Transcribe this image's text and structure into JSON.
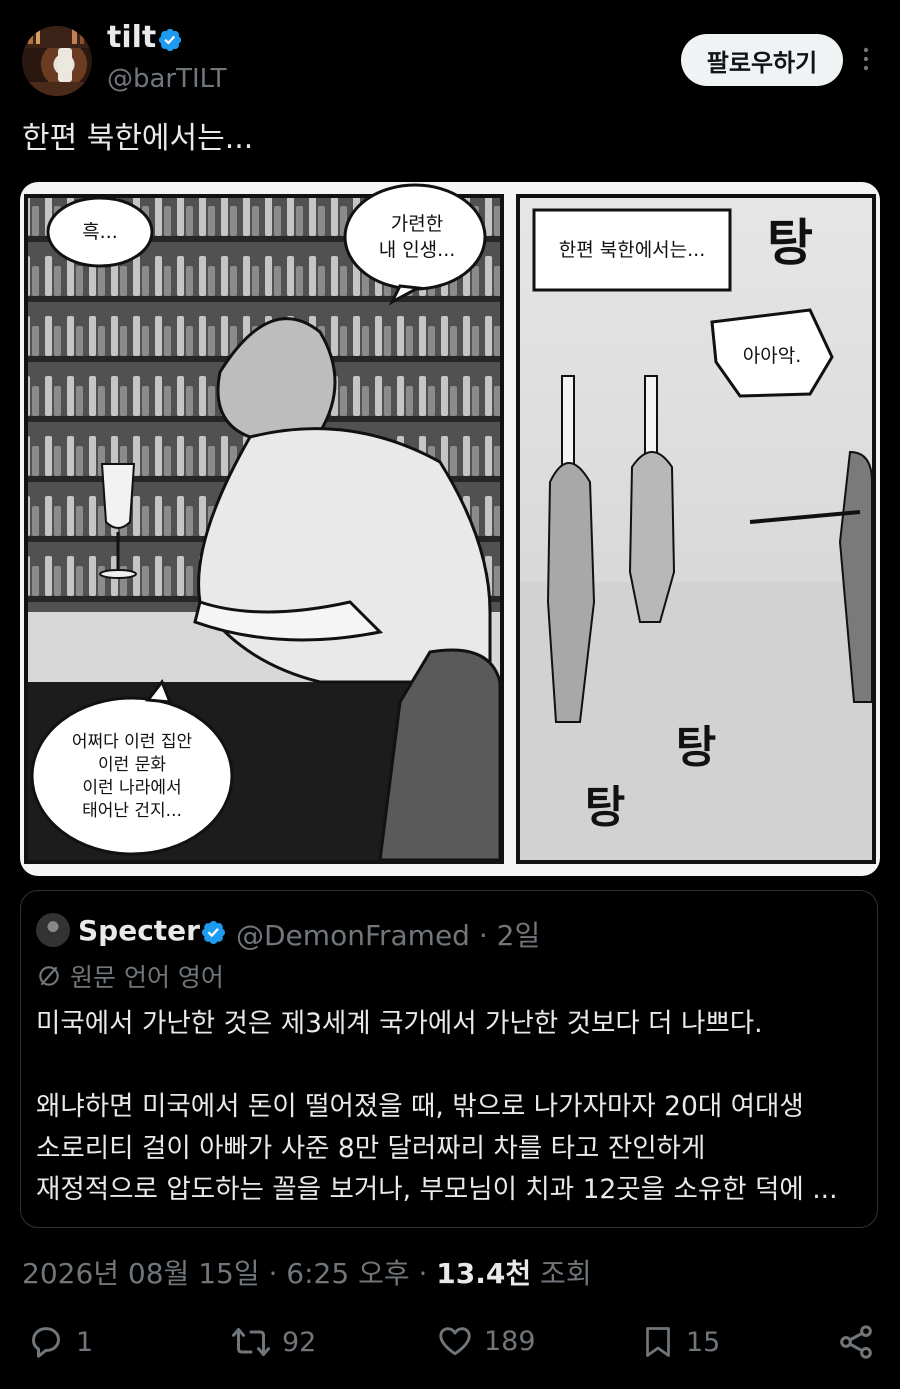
{
  "author": {
    "name": "tilt",
    "handle": "@barTILT"
  },
  "follow_label": "팔로우하기",
  "tweet_text": "한편 북한에서는...",
  "comic": {
    "bubble_heuk": "흑...",
    "bubble_pitiful_1": "가련한",
    "bubble_pitiful_2": "내 인생...",
    "bubble_born_1": "어쩌다 이런 집안",
    "bubble_born_2": "이런 문화",
    "bubble_born_3": "이런 나라에서",
    "bubble_born_4": "태어난 건지...",
    "caption": "한편 북한에서는...",
    "sfx_tang": "탕",
    "bubble_scream": "아아악."
  },
  "quote": {
    "name": "Specter",
    "handle_time": "@DemonFramed · 2일",
    "translated_from": "원문 언어 영어",
    "lines": [
      "미국에서 가난한 것은 제3세계 국가에서 가난한 것보다 더 나쁘다.",
      "",
      "왜냐하면 미국에서 돈이 떨어졌을 때, 밖으로 나가자마자 20대 여대생",
      "소로리티 걸이 아빠가 사준 8만 달러짜리 차를 타고 잔인하게",
      "재정적으로 압도하는 꼴을 보거나, 부모님이 치과 12곳을 소유한 덕에 ..."
    ]
  },
  "timestamp": "2026년 08월 15일 · 6:25 오후 · ",
  "views_count": "13.4천",
  "views_label": " 조회",
  "actions": {
    "replies": "1",
    "reposts": "92",
    "likes": "189",
    "bookmarks": "15"
  },
  "colors": {
    "background": "#000000",
    "text": "#e7e9ea",
    "muted": "#71767b",
    "verified": "#1d9bf0",
    "border": "#2f3336"
  }
}
